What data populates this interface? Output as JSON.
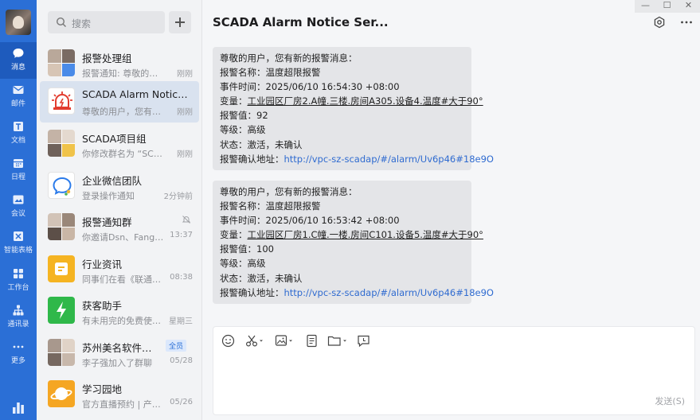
{
  "rail": {
    "items": [
      {
        "label": "消息",
        "icon": "chat-icon"
      },
      {
        "label": "邮件",
        "icon": "mail-icon"
      },
      {
        "label": "文档",
        "icon": "doc-icon"
      },
      {
        "label": "日程",
        "icon": "calendar-icon"
      },
      {
        "label": "会议",
        "icon": "meeting-icon"
      },
      {
        "label": "智能表格",
        "icon": "smart-table-icon"
      },
      {
        "label": "工作台",
        "icon": "workbench-icon"
      },
      {
        "label": "通讯录",
        "icon": "contacts-icon"
      },
      {
        "label": "更多",
        "icon": "more-icon"
      }
    ]
  },
  "search": {
    "placeholder": "搜索"
  },
  "conversations": [
    {
      "name": "报警处理组",
      "preview": "报警通知: 尊敬的用户...",
      "time": "刚刚"
    },
    {
      "name": "SCADA Alarm Notice Se...",
      "preview": "尊敬的用户，您有新的...",
      "time": "刚刚"
    },
    {
      "name": "SCADA项目组",
      "preview": "你修改群名为 “SCADA...",
      "time": "刚刚"
    },
    {
      "name": "企业微信团队",
      "preview": "登录操作通知",
      "time": "2分钟前"
    },
    {
      "name": "报警通知群",
      "preview": "你邀请Dsn、Fanggui...",
      "time": "13:37"
    },
    {
      "name": "行业资讯",
      "preview": "同事们在看《联通这...",
      "time": "08:38"
    },
    {
      "name": "获客助手",
      "preview": "有未用完的免费使用量",
      "time": "星期三"
    },
    {
      "name": "苏州美名软件有限...",
      "preview": "李子强加入了群聊",
      "time": "05/28",
      "badge": "全员"
    },
    {
      "name": "学习园地",
      "preview": "官方直播预约 | 产品...",
      "time": "05/26"
    }
  ],
  "window": {
    "minimize": "—",
    "maximize": "☐",
    "close": "✕"
  },
  "chat": {
    "title": "SCADA Alarm Notice Ser...",
    "messages": [
      {
        "greeting": "尊敬的用户，您有新的报警消息：",
        "alarm_name": "报警名称：温度超限报警",
        "event_time": "事件时间：2025/06/10 16:54:30 +08:00",
        "variable_prefix": "变量：",
        "variable": "工业园区厂房2.A幢.三楼.房间A305.设备4.温度#大于90°",
        "alarm_value": "报警值：92",
        "level": "等级：高级",
        "status": "状态：激活，未确认",
        "confirm_prefix": "报警确认地址：",
        "confirm_url": "http://vpc-sz-scadap/#/alarm/Uv6p46#18e9O"
      },
      {
        "greeting": "尊敬的用户，您有新的报警消息：",
        "alarm_name": "报警名称：温度超限报警",
        "event_time": "事件时间：2025/06/10 16:53:42 +08:00",
        "variable_prefix": "变量：",
        "variable": "工业园区厂房1.C幢.一楼.房间C101.设备5.温度#大于90°",
        "alarm_value": "报警值：100",
        "level": "等级：高级",
        "status": "状态：激活，未确认",
        "confirm_prefix": "报警确认地址：",
        "confirm_url": "http://vpc-sz-scadap/#/alarm/Uv6p46#18e9O"
      }
    ]
  },
  "composer": {
    "send_label": "发送(S)"
  },
  "colors": {
    "rail": "#2b6fd6",
    "link": "#2f6bd0",
    "bubble": "#e4e5e8"
  }
}
